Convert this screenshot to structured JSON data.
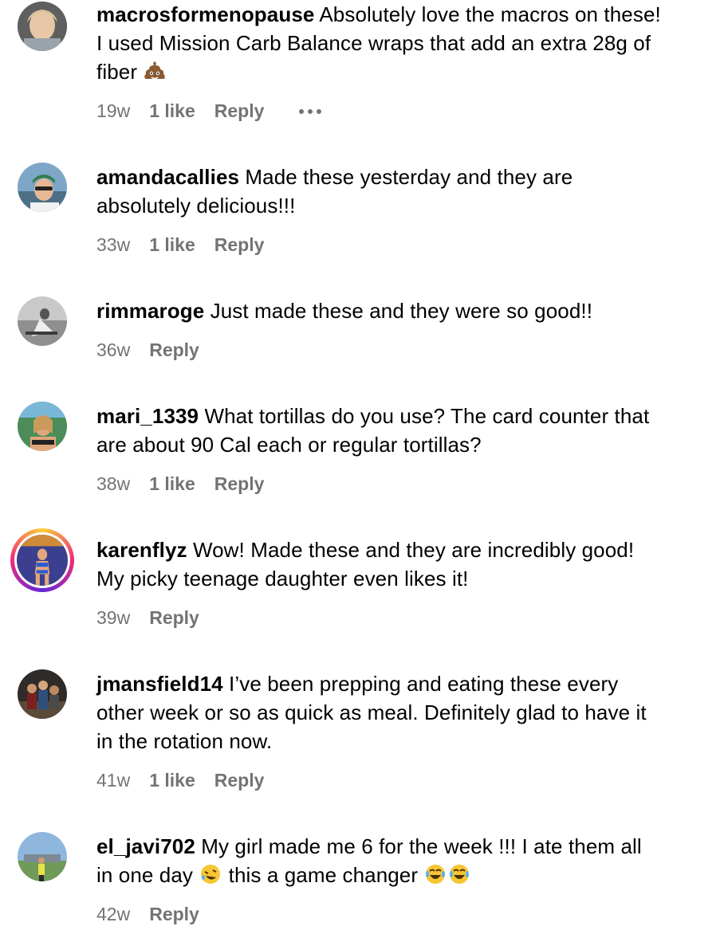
{
  "comments": [
    {
      "username": "macrosformenopause",
      "text_lines": [
        "Absolutely love the macros on these!",
        "I used Mission Carb Balance wraps that add an extra 28g of",
        "fiber"
      ],
      "emoji_end": "poop-emoji",
      "time": "19w",
      "likes": "1 like",
      "reply": "Reply",
      "more": "more-options"
    },
    {
      "username": "amandacallies",
      "text_lines": [
        "Made these yesterday and they are",
        "absolutely delicious!!!"
      ],
      "time": "33w",
      "likes": "1 like",
      "reply": "Reply"
    },
    {
      "username": "rimmaroge",
      "text_lines": [
        "Just made these and they were so good!!"
      ],
      "time": "36w",
      "reply": "Reply"
    },
    {
      "username": "mari_1339",
      "text_lines": [
        "What tortillas do you use? The card counter that",
        "are about 90 Cal each or regular tortillas?"
      ],
      "time": "38w",
      "likes": "1 like",
      "reply": "Reply"
    },
    {
      "username": "karenflyz",
      "text_lines": [
        "Wow! Made these and they are incredibly good!",
        "My picky teenage daughter even likes it!"
      ],
      "time": "39w",
      "reply": "Reply"
    },
    {
      "username": "jmansfield14",
      "text_lines": [
        "I’ve been prepping and eating these every",
        "other week or so as quick as meal. Definitely glad to have it",
        "in the rotation now."
      ],
      "time": "41w",
      "likes": "1 like",
      "reply": "Reply"
    },
    {
      "username": "el_javi702",
      "text_lines": [
        "My girl made me 6 for the week !!! I ate them all",
        "in one day",
        "this a game changer"
      ],
      "time": "42w",
      "reply": "Reply"
    }
  ],
  "colors": {
    "meta": "#737373",
    "text": "#000000",
    "story_ring": [
      "#f9ce34",
      "#ee2a7b",
      "#6228d7"
    ]
  }
}
